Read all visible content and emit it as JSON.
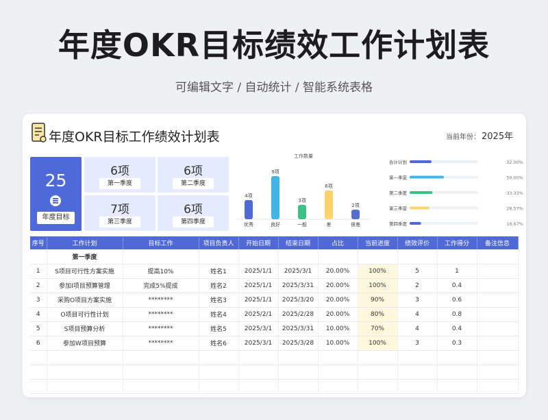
{
  "header": {
    "title": "年度OKR目标绩效工作计划表",
    "subtitle": "可编辑文字 / 自动统计 / 智能系统表格"
  },
  "sheet": {
    "title": "年度OKR目标工作绩效计划表",
    "year_label": "当前年份：",
    "year_value": "2025年"
  },
  "summary": {
    "total": "25",
    "total_label": "年度目标",
    "quarters": [
      {
        "value": "6项",
        "label": "第一季度"
      },
      {
        "value": "6项",
        "label": "第二季度"
      },
      {
        "value": "7项",
        "label": "第三季度"
      },
      {
        "value": "6项",
        "label": "第四季度"
      }
    ]
  },
  "chart_data": [
    {
      "type": "bar",
      "title": "工作数量",
      "categories": [
        "优秀",
        "良好",
        "一般",
        "差",
        "很差"
      ],
      "values": [
        4,
        9,
        3,
        6,
        2
      ],
      "value_labels": [
        "4项",
        "9项",
        "3项",
        "6项",
        "2项"
      ],
      "colors": [
        "#4f6ad7",
        "#42b4e6",
        "#3dbf86",
        "#fdd36a",
        "#5570cc"
      ]
    },
    {
      "type": "bar",
      "orientation": "horizontal",
      "categories": [
        "合计计划",
        "第一季度",
        "第二季度",
        "第三季度",
        "第四季度"
      ],
      "values": [
        32.0,
        50.0,
        33.33,
        28.57,
        16.67
      ],
      "value_labels": [
        "32.00%",
        "50.00%",
        "33.33%",
        "28.57%",
        "16.67%"
      ],
      "colors": [
        "#4f6ad7",
        "#42b4e6",
        "#3dbf86",
        "#fdd36a",
        "#4f6ad7"
      ],
      "xlim": [
        0,
        100
      ]
    }
  ],
  "table": {
    "columns": [
      "序号",
      "工作计划",
      "目标工作",
      "项目负责人",
      "开始日期",
      "结束日期",
      "占比",
      "当前进度",
      "绩效评价",
      "工作得分",
      "备注信息"
    ],
    "section_label": "第一季度",
    "rows": [
      [
        "1",
        "S项目可行性方案实施",
        "提高10%",
        "姓名1",
        "2025/1/1",
        "2025/3/1",
        "20.00%",
        "100%",
        "5",
        "1",
        ""
      ],
      [
        "2",
        "参加I项目预算管理",
        "完成5%提成",
        "姓名2",
        "2025/1/1",
        "2025/3/31",
        "20.00%",
        "100%",
        "2",
        "0.4",
        ""
      ],
      [
        "3",
        "采购O项目方案实施",
        "********",
        "姓名3",
        "2025/1/1",
        "2025/3/20",
        "20.00%",
        "90%",
        "3",
        "0.6",
        ""
      ],
      [
        "4",
        "O项目可行性计划",
        "********",
        "姓名4",
        "2025/2/1",
        "2025/2/28",
        "20.00%",
        "80%",
        "4",
        "0.8",
        ""
      ],
      [
        "5",
        "S项目预算分析",
        "********",
        "姓名5",
        "2025/3/1",
        "2025/3/31",
        "10.00%",
        "70%",
        "4",
        "0.4",
        ""
      ],
      [
        "6",
        "参加W项目预算",
        "********",
        "姓名6",
        "2025/3/1",
        "2025/3/28",
        "10.00%",
        "100%",
        "3",
        "0.3",
        ""
      ],
      [
        "",
        "",
        "",
        "",
        "",
        "",
        "",
        "",
        "",
        "",
        ""
      ],
      [
        "",
        "",
        "",
        "",
        "",
        "",
        "",
        "",
        "",
        "",
        ""
      ],
      [
        "",
        "",
        "",
        "",
        "",
        "",
        "",
        "",
        "",
        "",
        ""
      ]
    ]
  }
}
